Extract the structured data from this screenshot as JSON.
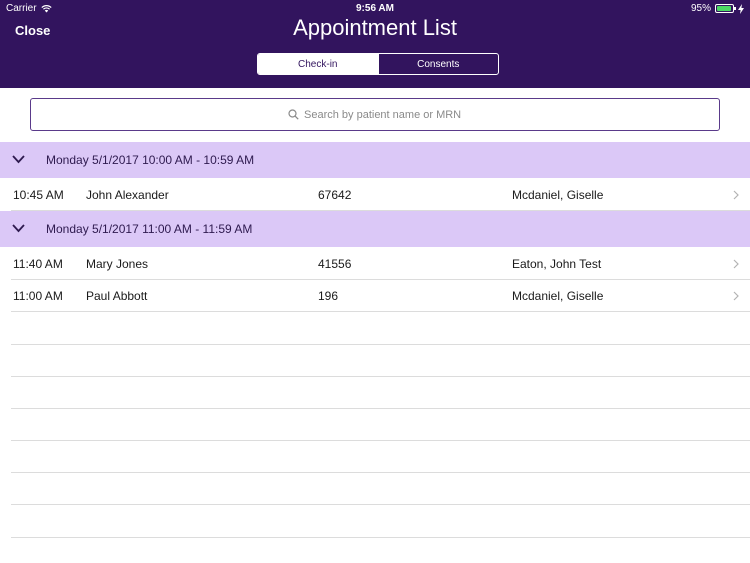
{
  "status_bar": {
    "carrier": "Carrier",
    "time": "9:56 AM",
    "battery": "95%"
  },
  "header": {
    "close_label": "Close",
    "title": "Appointment List",
    "tabs": [
      {
        "label": "Check-in",
        "active": true
      },
      {
        "label": "Consents",
        "active": false
      }
    ]
  },
  "search": {
    "placeholder": "Search by patient name or MRN",
    "value": ""
  },
  "groups": [
    {
      "label": "Monday 5/1/2017 10:00 AM - 10:59 AM",
      "rows": [
        {
          "time": "10:45 AM",
          "patient": "John Alexander",
          "mrn": "67642",
          "provider": "Mcdaniel, Giselle"
        }
      ]
    },
    {
      "label": "Monday 5/1/2017 11:00 AM - 11:59 AM",
      "rows": [
        {
          "time": "11:40 AM",
          "patient": "Mary Jones",
          "mrn": "41556",
          "provider": "Eaton, John Test"
        },
        {
          "time": "11:00 AM",
          "patient": "Paul Abbott",
          "mrn": "196",
          "provider": "Mcdaniel, Giselle"
        }
      ]
    }
  ],
  "colors": {
    "header": "#32145e",
    "group_header": "#dbc8f7",
    "battery": "#4cd964"
  }
}
